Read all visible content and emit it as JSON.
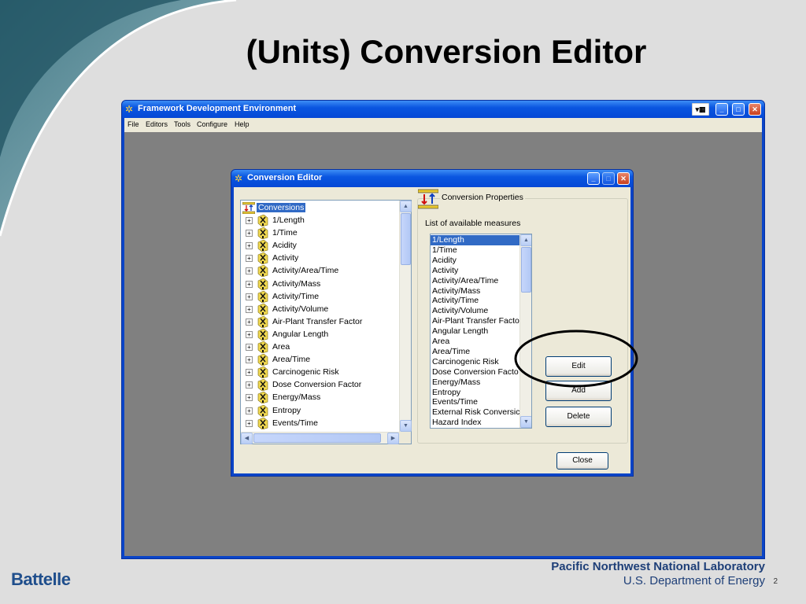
{
  "slide": {
    "title": "(Units) Conversion Editor",
    "footer_left": "Battelle",
    "footer_org": "Pacific Northwest National Laboratory",
    "footer_dept": "U.S. Department of Energy",
    "page_number": "2"
  },
  "app": {
    "title": "Framework Development Environment",
    "menu": [
      "File",
      "Editors",
      "Tools",
      "Configure",
      "Help"
    ]
  },
  "dialog": {
    "title": "Conversion Editor",
    "tree_root": "Conversions",
    "tree_items": [
      "1/Length",
      "1/Time",
      "Acidity",
      "Activity",
      "Activity/Area/Time",
      "Activity/Mass",
      "Activity/Time",
      "Activity/Volume",
      "Air-Plant Transfer Factor",
      "Angular Length",
      "Area",
      "Area/Time",
      "Carcinogenic Risk",
      "Dose Conversion Factor",
      "Energy/Mass",
      "Entropy",
      "Events/Time"
    ],
    "properties_title": "Conversion Properties",
    "list_label": "List of available measures",
    "measures": [
      "1/Length",
      "1/Time",
      "Acidity",
      "Activity",
      "Activity/Area/Time",
      "Activity/Mass",
      "Activity/Time",
      "Activity/Volume",
      "Air-Plant Transfer Facto",
      "Angular Length",
      "Area",
      "Area/Time",
      "Carcinogenic Risk",
      "Dose Conversion Facto",
      "Energy/Mass",
      "Entropy",
      "Events/Time",
      "External Risk Conversic",
      "Hazard Index"
    ],
    "selected_measure": "1/Length",
    "buttons": {
      "edit": "Edit",
      "add": "Add",
      "delete": "Delete",
      "close": "Close"
    }
  },
  "colors": {
    "xp_title": "#0a56e0",
    "selection": "#316ac5",
    "workspace": "#808080",
    "dialog_face": "#ece9d8"
  }
}
